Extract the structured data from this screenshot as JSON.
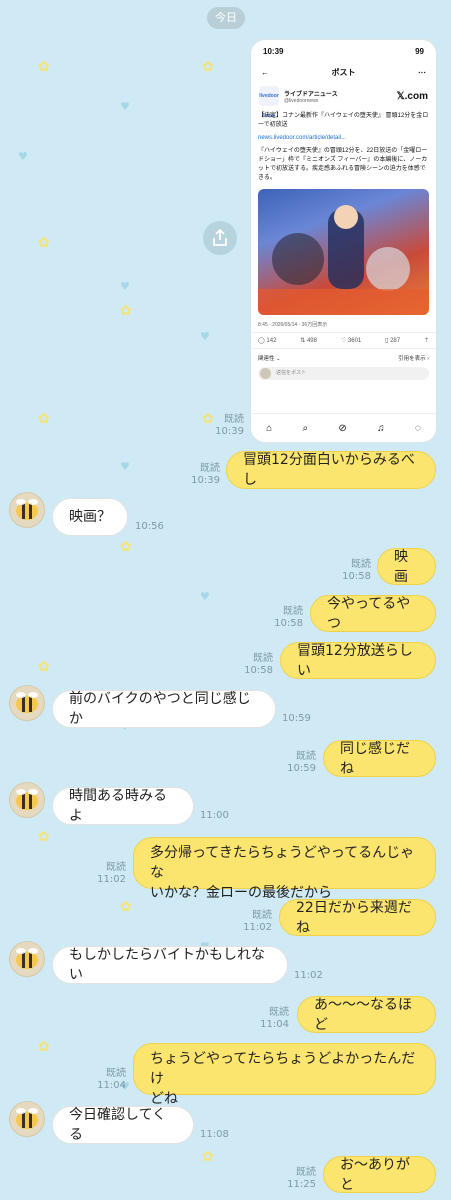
{
  "date_label": "今日",
  "shared_post": {
    "status_time": "10:39",
    "status_battery": "99",
    "header_title": "ポスト",
    "account_name": "ライブドアニュース",
    "account_handle": "@livedoornews",
    "logo_text": "livedoor News",
    "site_mark": "𝕏.com",
    "headline": "【決定】コナン最新作『ハイウェイの堕天使』 冒頭12分を金ローで初放送",
    "link": "news.livedoor.com/article/detail...",
    "body": "『ハイウェイの堕天使』の冒頭12分を、22日放送の「金曜ロードショー」枠で『ミニオンズ フィーバー』の本編後に、ノーカットで初放送する。疾走感あふれる冒険シーンの迫力を体感できる。",
    "stats": "8:45 · 2026/05/14 · 36万回表示",
    "replies": "142",
    "reposts": "498",
    "likes": "3601",
    "bookmarks": "287",
    "related_label": "関連性 ⌄",
    "quote_label": "引用を表示 ›",
    "reply_placeholder": "返信をポスト",
    "read": "既読",
    "time": "10:39"
  },
  "messages": [
    {
      "text": "冒頭12分面白いからみるべし",
      "read": "既読",
      "time": "10:39"
    },
    {
      "text": "映画？",
      "time": "10:56"
    },
    {
      "text": "映画",
      "read": "既読",
      "time": "10:58"
    },
    {
      "text": "今やってるやつ",
      "read": "既読",
      "time": "10:58"
    },
    {
      "text": "冒頭12分放送らしい",
      "read": "既読",
      "time": "10:58"
    },
    {
      "text": "前のバイクのやつと同じ感じか",
      "time": "10:59"
    },
    {
      "text": "同じ感じだね",
      "read": "既読",
      "time": "10:59"
    },
    {
      "text": "時間ある時みるよ",
      "time": "11:00"
    },
    {
      "text_line1": "多分帰ってきたらちょうどやってるんじゃな",
      "text_line2": "いかな？金ローの最後だから",
      "read": "既読",
      "time": "11:02"
    },
    {
      "text": "22日だから来週だね",
      "read": "既読",
      "time": "11:02"
    },
    {
      "text": "もしかしたらバイトかもしれない",
      "time": "11:02"
    },
    {
      "text": "あ〜〜〜なるほど",
      "read": "既読",
      "time": "11:04"
    },
    {
      "text_line1": "ちょうどやってたらちょうどよかったんだけ",
      "text_line2": "どね",
      "read": "既読",
      "time": "11:04"
    },
    {
      "text": "今日確認してくる",
      "time": "11:08"
    },
    {
      "text": "お〜ありがと",
      "read": "既読",
      "time": "11:25"
    }
  ],
  "colors": {
    "background": "#cfeaf4",
    "my_bubble": "#fbe56e",
    "their_bubble": "#ffffff",
    "meta": "#7f9aa5"
  },
  "icons": {
    "share": "share-icon",
    "avatar": "bee-avatar-icon"
  }
}
